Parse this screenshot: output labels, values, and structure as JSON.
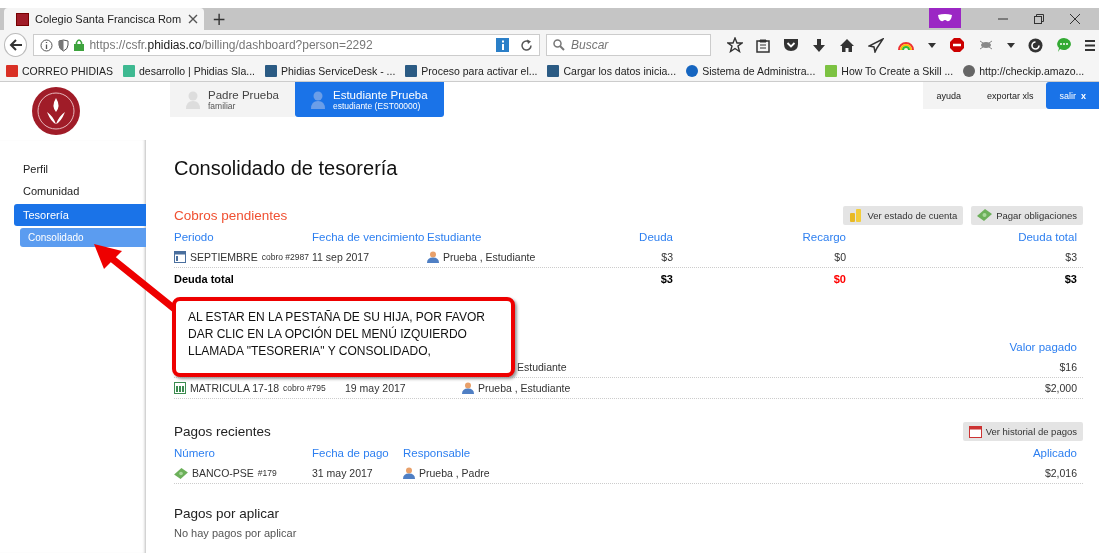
{
  "browser": {
    "tab_title": "Colegio Santa Francisca Rom",
    "new_tab": "+",
    "url_prefix": "https://csfr.",
    "url_host": "phidias.co",
    "url_path": "/billing/dashboard?person=2292",
    "search_placeholder": "Buscar",
    "bookmarks": [
      {
        "label": "CORREO PHIDIAS"
      },
      {
        "label": "desarrollo | Phidias Sla..."
      },
      {
        "label": "Phidias ServiceDesk - ..."
      },
      {
        "label": "Proceso para activar el..."
      },
      {
        "label": "Cargar los datos inicia..."
      },
      {
        "label": "Sistema de Administra..."
      },
      {
        "label": "How To Create a Skill ..."
      },
      {
        "label": "http://checkip.amazo..."
      }
    ]
  },
  "user_tabs": [
    {
      "name": "Padre Prueba",
      "role": "familiar",
      "selected": false
    },
    {
      "name": "Estudiante Prueba",
      "role": "estudiante (EST00000)",
      "selected": true
    }
  ],
  "top_actions": [
    {
      "label": "ayuda",
      "kind": "plain"
    },
    {
      "label": "exportar xls",
      "kind": "plain"
    },
    {
      "label": "salir",
      "close": "x",
      "kind": "primary"
    }
  ],
  "sidebar": {
    "items": [
      {
        "label": "Perfil",
        "selected": false
      },
      {
        "label": "Comunidad",
        "selected": false
      },
      {
        "label": "Tesorería",
        "selected": true,
        "children": [
          {
            "label": "Consolidado",
            "selected": true
          }
        ]
      }
    ]
  },
  "page_title": "Consolidado de tesorería",
  "pending": {
    "title": "Cobros pendientes",
    "actions": [
      {
        "label": "Ver estado de cuenta",
        "kind": "coins"
      },
      {
        "label": "Pagar obligaciones",
        "kind": "money"
      }
    ],
    "columns": [
      "Periodo",
      "Fecha de vencimiento",
      "Estudiante",
      "Deuda",
      "Recargo",
      "Deuda total"
    ],
    "rows": [
      {
        "period": "SEPTIEMBRE",
        "charge": "cobro #2987",
        "due": "11 sep 2017",
        "student": "Prueba , Estudiante",
        "debt": "$3",
        "surcharge": "$0",
        "total": "$3"
      }
    ],
    "total": {
      "label": "Deuda total",
      "debt": "$3",
      "surcharge": "$0",
      "total": "$3"
    }
  },
  "paid": {
    "value_column": "Valor pagado",
    "rows": [
      {
        "student": "Estudiante",
        "value": "$16"
      },
      {
        "period": "MATRICULA 17-18",
        "charge": "cobro #795",
        "date": "19 may 2017",
        "student": "Prueba , Estudiante",
        "value": "$2,000"
      }
    ]
  },
  "recent": {
    "title": "Pagos recientes",
    "action": "Ver historial de pagos",
    "columns": [
      "Número",
      "Fecha de pago",
      "Responsable",
      "Aplicado"
    ],
    "rows": [
      {
        "number": "BANCO-PSE",
        "ref": "#179",
        "date": "31 may 2017",
        "person": "Prueba , Padre",
        "applied": "$2,016"
      }
    ]
  },
  "unapplied": {
    "title": "Pagos por aplicar",
    "empty": "No hay pagos por aplicar"
  },
  "callout": {
    "text": "AL ESTAR EN LA PESTAÑA DE SU HIJA, POR FAVOR DAR CLIC EN LA OPCIÓN DEL MENÚ IZQUIERDO LLAMADA \"TESORERIA\" Y CONSOLIDADO,"
  }
}
